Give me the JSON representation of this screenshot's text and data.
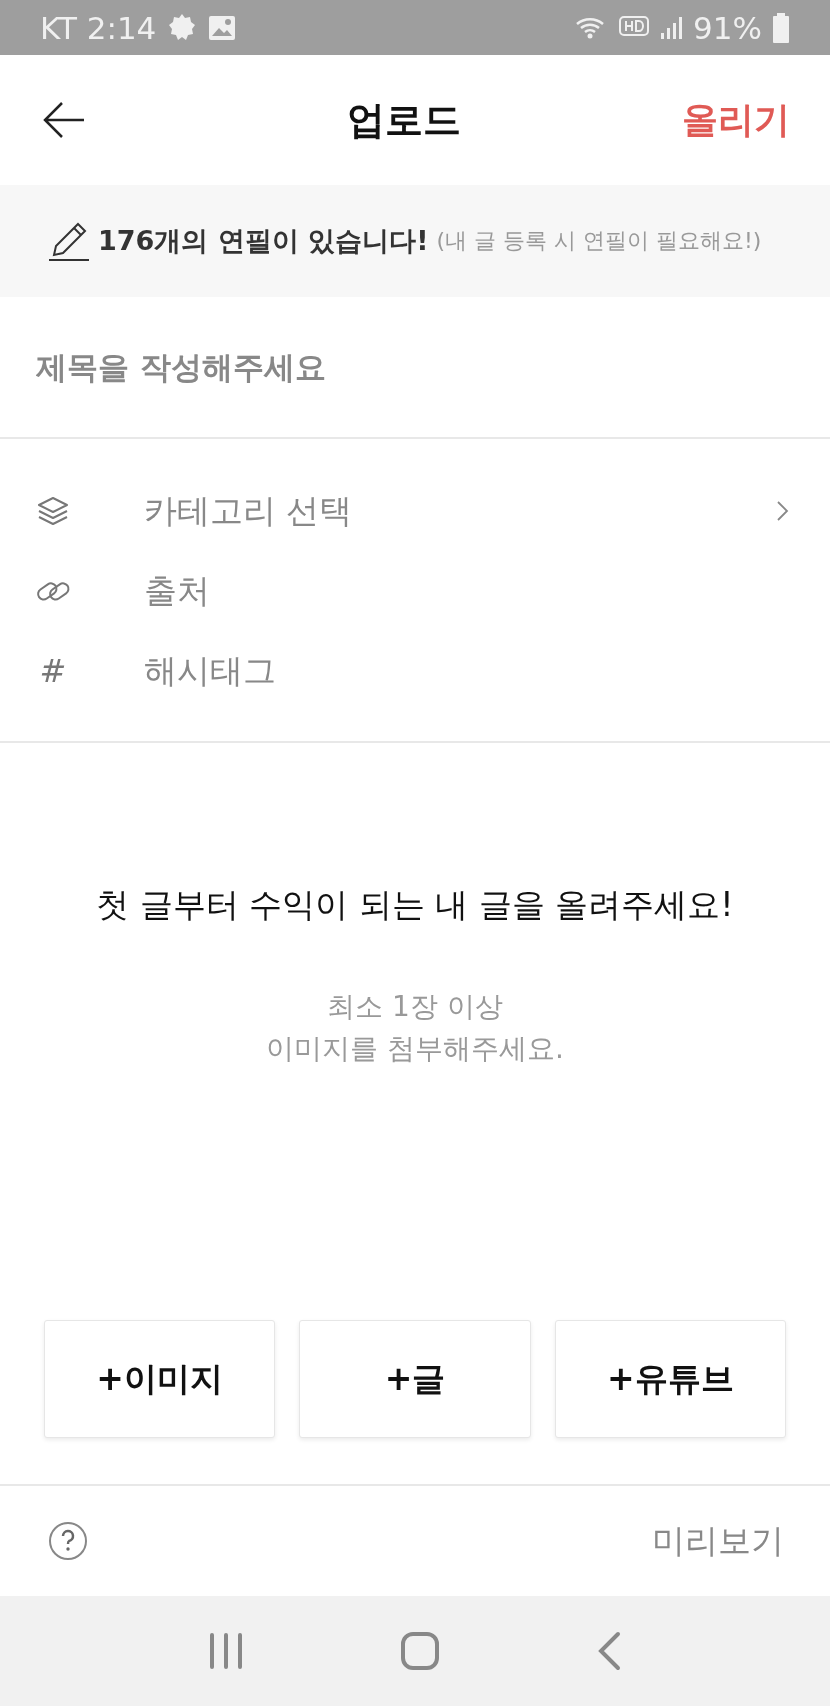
{
  "status_bar": {
    "carrier_time": "KT 2:14",
    "battery": "91%"
  },
  "header": {
    "title": "업로드",
    "action": "올리기"
  },
  "banner": {
    "count_text": "176개의 연필이 있습니다!",
    "note": "(내 글 등록 시 연필이 필요해요!)"
  },
  "title_field": {
    "placeholder": "제목을 작성해주세요"
  },
  "options": [
    {
      "kind": "category",
      "label": "카테고리 선택",
      "has_chevron": true
    },
    {
      "kind": "source",
      "label": "출처",
      "has_chevron": false
    },
    {
      "kind": "hashtag",
      "icon": "#",
      "label": "해시태그",
      "has_chevron": false
    }
  ],
  "empty_state": {
    "headline": "첫 글부터 수익이 되는 내 글을 올려주세요!",
    "hint_lines": [
      "최소 1장 이상",
      "이미지를 첨부해주세요."
    ]
  },
  "add_buttons": [
    "+이미지",
    "+글",
    "+유튜브"
  ],
  "footer": {
    "preview": "미리보기"
  }
}
